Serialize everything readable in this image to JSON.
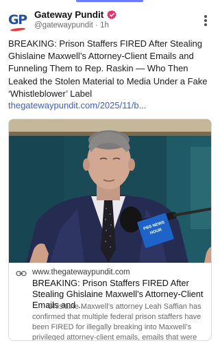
{
  "post": {
    "author": {
      "name": "Gateway Pundit",
      "handle": "@gatewaypundit",
      "time": "1h",
      "avatar_text": "GP",
      "verified": true
    },
    "headline": "BREAKING: Prison Staffers FIRED After Stealing Ghislaine Maxwell’s Attorney-Client Emails and Funneling Them to Rep. Raskin — Who Then Leaked the Stolen Material to Media Under a Fake ‘Whistleblower’ Label",
    "link_text": "thegatewaypundit.com/2025/11/b...",
    "card": {
      "domain": "www.thegatewaypundit.com",
      "title": "BREAKING: Prison Staffers FIRED After Stealing Ghislaine Maxwell’s Attorney-Client Emails and ...",
      "description": "Ghislaine Maxwell’s attorney Leah Saffian has confirmed that multiple federal prison staffers have been FIRED for illegally breaking into Maxwell’s privileged attorney-client emails, emails that were the...",
      "mic_text": "PBS NEWS HOUR"
    }
  },
  "colors": {
    "accent_link": "#3a5fcc",
    "verified_badge": "#e8336d",
    "brand_blue": "#1f4fa6",
    "brand_red": "#e4403b"
  },
  "icons": {
    "more": "more-vertical-icon",
    "verified": "verified-badge-icon",
    "link": "link-icon"
  }
}
